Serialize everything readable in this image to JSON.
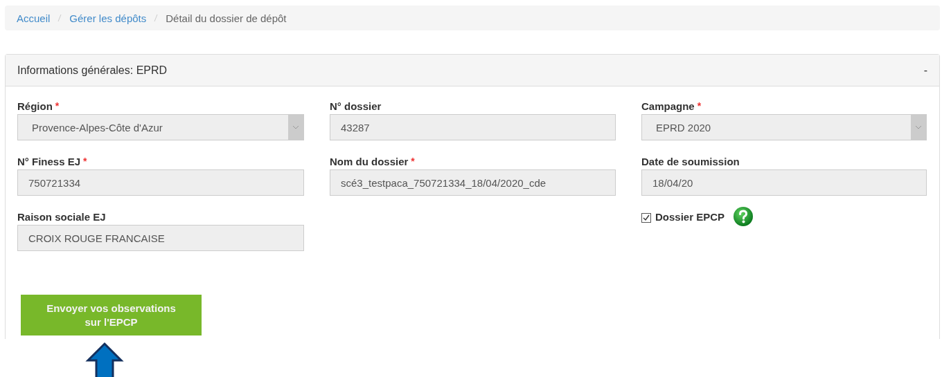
{
  "breadcrumb": [
    {
      "label": "Accueil",
      "kind": "link"
    },
    {
      "label": "Gérer les dépôts",
      "kind": "link"
    },
    {
      "label": "Détail du dossier de dépôt",
      "kind": "current"
    }
  ],
  "panel": {
    "title": "Informations générales: EPRD",
    "toggle": "-",
    "columns": [
      [
        {
          "kind": "select",
          "label": "Région",
          "required_mark": "*",
          "value": "Provence-Alpes-Côte d'Azur"
        },
        {
          "kind": "text",
          "label": "N° Finess EJ",
          "required_mark": "*",
          "value": "750721334"
        },
        {
          "kind": "text",
          "label": "Raison sociale EJ",
          "value": "CROIX ROUGE FRANCAISE"
        }
      ],
      [
        {
          "kind": "text",
          "label": "N° dossier",
          "value": "43287"
        },
        {
          "kind": "text",
          "label": "Nom du dossier",
          "required_mark": "*",
          "value": "scé3_testpaca_750721334_18/04/2020_cde"
        }
      ],
      [
        {
          "kind": "select",
          "label": "Campagne",
          "required_mark": "*",
          "value": "EPRD 2020"
        },
        {
          "kind": "text",
          "label": "Date de soumission",
          "value": "18/04/20"
        },
        {
          "kind": "checkbox",
          "label": "Dossier EPCP",
          "checked": true
        }
      ]
    ],
    "button": "Envoyer vos observations sur l'EPCP"
  }
}
